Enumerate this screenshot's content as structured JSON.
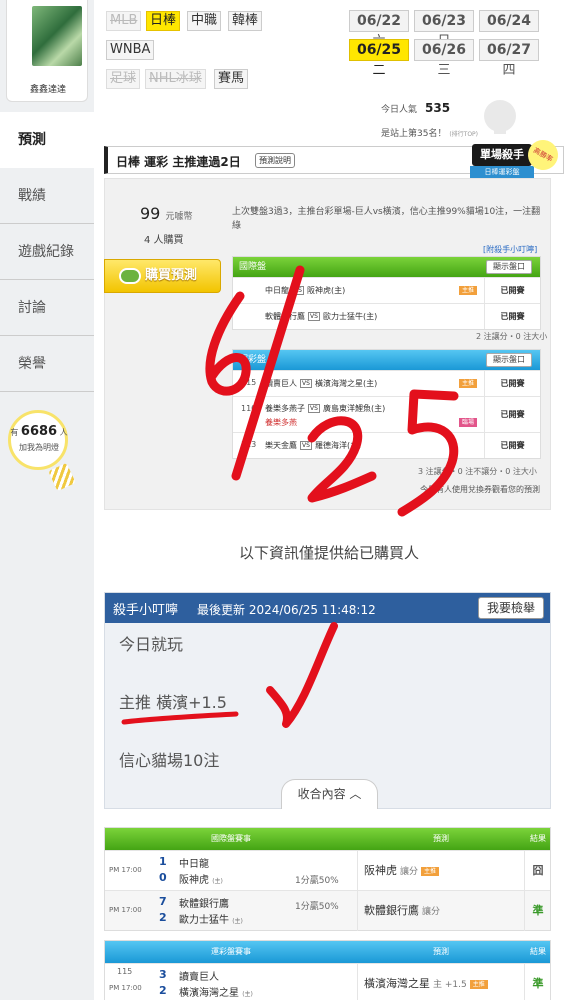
{
  "user": {
    "name": "鑫鑫達達"
  },
  "nav": [
    {
      "label": "預測",
      "active": true
    },
    {
      "label": "戰績"
    },
    {
      "label": "遊戲紀錄"
    },
    {
      "label": "討論"
    },
    {
      "label": "榮譽"
    }
  ],
  "helpers": {
    "prefix": "有",
    "count": "6686",
    "unit": "人",
    "note": "加我為明燈"
  },
  "sports": [
    {
      "label": "MLB",
      "state": "disabled"
    },
    {
      "label": "日棒",
      "state": "active"
    },
    {
      "label": "中職",
      "state": "normal"
    },
    {
      "label": "韓棒",
      "state": "normal"
    },
    {
      "label": "WNBA",
      "state": "normal"
    },
    {
      "label": "足球",
      "state": "disabled"
    },
    {
      "label": "NHL冰球",
      "state": "disabled"
    },
    {
      "label": "賽馬",
      "state": "normal"
    }
  ],
  "dates": [
    {
      "md": "06/22",
      "day": "六"
    },
    {
      "md": "06/23",
      "day": "日"
    },
    {
      "md": "06/24",
      "day": "一"
    },
    {
      "md": "06/25",
      "day": "二",
      "active": true
    },
    {
      "md": "06/26",
      "day": "三"
    },
    {
      "md": "06/27",
      "day": "四"
    }
  ],
  "stats": {
    "popularity_label": "今日人氣",
    "popularity": "535",
    "rank_text": "是站上第35名！",
    "rank_small": "(排行TOP)"
  },
  "plan": {
    "title": "日棒 運彩 主推連過2日",
    "rule_label": "預測說明",
    "badge_main": "單場殺手",
    "badge_sub": "日棒運彩盤",
    "badge_seal": "高勝率",
    "price": "99",
    "price_unit": "元噱幣",
    "buyers": "4 人購買",
    "summary": "上次雙盤3過3，主推台彩單場-巨人vs橫濱，信心主推99%貓場10注，一注翻綠",
    "buy_label": "購買預測",
    "tip_link": "[附殺手小叮嚀]"
  },
  "intl_table": {
    "header": "國際盤",
    "show_label": "顯示盤口",
    "rows": [
      {
        "num": "",
        "away": "中日龍",
        "home": "阪神虎(主)",
        "tag": "主推",
        "tag_color": "orange",
        "state": "已開賽"
      },
      {
        "num": "",
        "away": "軟體銀行鷹",
        "home": "歐力士猛牛(主)",
        "tag": "",
        "state": "已開賽"
      }
    ],
    "note": "2 注讓分・0 注大小"
  },
  "lottery_table": {
    "header": "運彩盤",
    "show_label": "顯示盤口",
    "rows": [
      {
        "num": "115",
        "away": "讀賣巨人",
        "home": "橫濱海灣之星(主)",
        "tag": "主推",
        "tag_color": "orange",
        "state": "已開賽"
      },
      {
        "num": "110",
        "away": "養樂多燕子",
        "home": "廣島東洋鯉魚(主)",
        "tag": "臨場",
        "tag_color": "pink",
        "state": "已開賽",
        "sub": "養樂多燕"
      },
      {
        "num": "113",
        "away": "樂天金鷹",
        "home": "羅德海洋(主)",
        "tag": "",
        "state": "已開賽"
      }
    ],
    "note": "3 注讓分・0 注不讓分・0 注大小",
    "hint": "今日有人使用兌換券觀看您的預測"
  },
  "only_buyers": "以下資訊僅提供給已購買人",
  "tips": {
    "title": "殺手小叮嚀",
    "updated_label": "最後更新",
    "updated": "2024/06/25 11:48:12",
    "report_label": "我要檢舉",
    "lines": [
      "今日就玩",
      "主推 橫濱+1.5",
      "信心貓場10注"
    ],
    "collapse_label": "收合內容"
  },
  "results_intl": {
    "headers": [
      "國際盤賽事",
      "預測",
      "結果"
    ],
    "rows": [
      {
        "time": "PM 17:00",
        "away_score": "1",
        "home_score": "0",
        "away": "中日龍",
        "home": "阪神虎",
        "home_mark": "(主)",
        "line": "1分贏50%",
        "pick": "阪神虎",
        "pick_label": "讓分",
        "pick_tag": "主推",
        "result": "囧",
        "result_color": "#555555"
      },
      {
        "time": "PM 17:00",
        "away_score": "7",
        "home_score": "2",
        "away": "軟體銀行鷹",
        "home": "歐力士猛牛",
        "home_mark": "(主)",
        "line": "1分贏50%",
        "pick": "軟體銀行鷹",
        "pick_label": "讓分",
        "pick_tag": "",
        "result": "準",
        "result_color": "#3a9a2a"
      }
    ]
  },
  "results_lottery": {
    "headers": [
      "運彩盤賽事",
      "預測",
      "結果"
    ],
    "rows": [
      {
        "time": "PM 17:00",
        "num": "115",
        "away_score": "3",
        "home_score": "2",
        "away": "讀賣巨人",
        "home": "橫濱海灣之星",
        "home_mark": "(主)",
        "pick": "橫濱海灣之星",
        "pick_label": "主 +1.5",
        "pick_tag": "主推",
        "result": "準",
        "result_color": "#3a9a2a"
      }
    ]
  },
  "handwriting": {
    "date": "6/25"
  }
}
